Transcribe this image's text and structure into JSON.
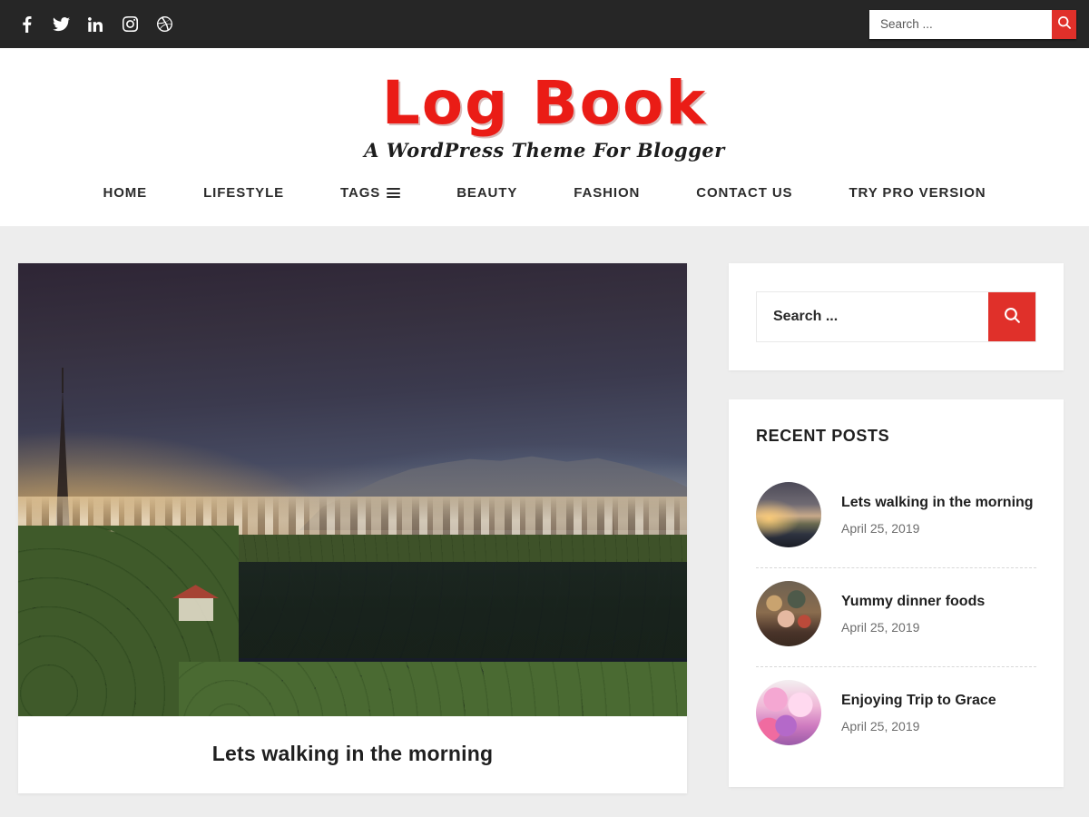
{
  "topbar": {
    "social": [
      {
        "name": "facebook-icon",
        "label": "Facebook"
      },
      {
        "name": "twitter-icon",
        "label": "Twitter"
      },
      {
        "name": "linkedin-icon",
        "label": "LinkedIn"
      },
      {
        "name": "instagram-icon",
        "label": "Instagram"
      },
      {
        "name": "dribbble-icon",
        "label": "Dribbble"
      }
    ],
    "search": {
      "value": "",
      "placeholder": "Search ...",
      "button_icon": "search-icon"
    }
  },
  "header": {
    "logo_text": "Log Book",
    "tagline": "A WordPress Theme For Blogger",
    "logo_color": "#ea1c16"
  },
  "nav": {
    "items": [
      {
        "label": "HOME",
        "has_menu_icon": false
      },
      {
        "label": "LIFESTYLE",
        "has_menu_icon": false
      },
      {
        "label": "TAGS",
        "has_menu_icon": true
      },
      {
        "label": "BEAUTY",
        "has_menu_icon": false
      },
      {
        "label": "FASHION",
        "has_menu_icon": false
      },
      {
        "label": "CONTACT US",
        "has_menu_icon": false
      },
      {
        "label": "TRY PRO VERSION",
        "has_menu_icon": false
      }
    ]
  },
  "main": {
    "featured_post": {
      "image_alt": "Sunrise over a lake with a town, palm trees and mountains",
      "title": "Lets walking in the morning"
    }
  },
  "sidebar": {
    "search_widget": {
      "value": "",
      "placeholder": "Search ...",
      "button_icon": "search-icon",
      "button_color": "#e0302a"
    },
    "recent_posts_widget": {
      "title": "RECENT POSTS",
      "items": [
        {
          "title": "Lets walking in the morning",
          "date": "April 25, 2019",
          "thumb": "lake-sunrise-thumbnail"
        },
        {
          "title": "Yummy dinner foods",
          "date": "April 25, 2019",
          "thumb": "food-plate-thumbnail"
        },
        {
          "title": "Enjoying Trip to Grace",
          "date": "April 25, 2019",
          "thumb": "pink-flowers-thumbnail"
        }
      ]
    }
  }
}
